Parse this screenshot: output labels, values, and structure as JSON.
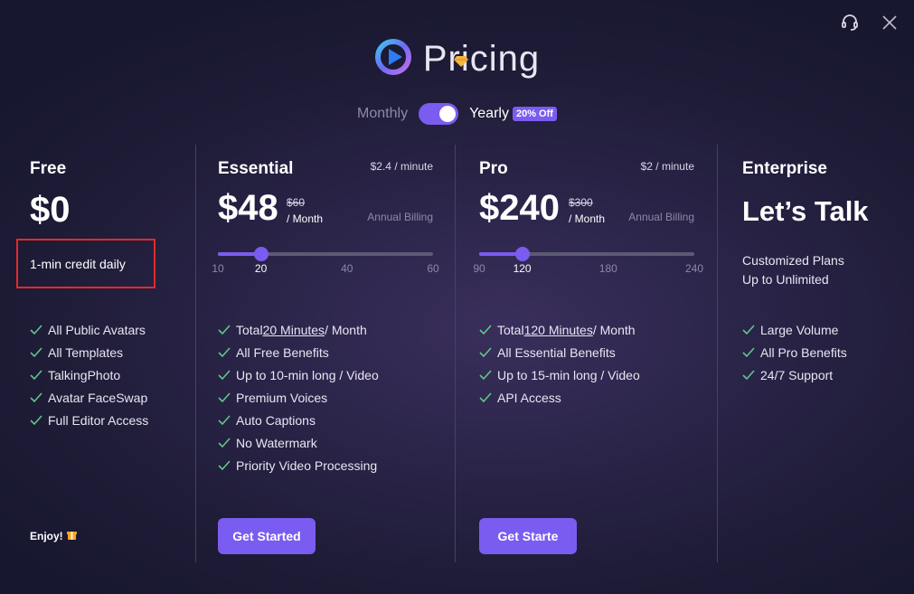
{
  "header": {
    "title": "Pricing",
    "icons": {
      "support": "headset-icon",
      "close": "close-icon",
      "logo": "play-logo-icon",
      "premium": "diamond-icon"
    }
  },
  "billing": {
    "monthly_label": "Monthly",
    "yearly_label": "Yearly",
    "discount_badge": "20% Off",
    "selected": "Yearly"
  },
  "colors": {
    "accent": "#7b5cf0",
    "highlight_border": "#e02b2b",
    "check": "#5fc78a"
  },
  "plans": {
    "free": {
      "name": "Free",
      "price": "$0",
      "credit": "1-min credit daily",
      "features": [
        "All Public Avatars",
        "All Templates",
        "TalkingPhoto",
        "Avatar FaceSwap",
        "Full Editor Access"
      ],
      "footer": "Enjoy!"
    },
    "essential": {
      "name": "Essential",
      "per_minute": "$2.4 / minute",
      "price": "$48",
      "original_price": "$60",
      "period": "/ Month",
      "billing_note": "Annual Billing",
      "slider": {
        "min": 10,
        "max": 60,
        "value": 20,
        "ticks": [
          "10",
          "20",
          "40",
          "60"
        ]
      },
      "features_total": {
        "prefix": "Total ",
        "amount": "20 Minutes",
        "suffix": " / Month"
      },
      "features": [
        "All Free Benefits",
        "Up to 10-min long / Video",
        "Premium Voices",
        "Auto Captions",
        "No Watermark",
        "Priority Video Processing"
      ],
      "cta": "Get Started"
    },
    "pro": {
      "name": "Pro",
      "per_minute": "$2 / minute",
      "price": "$240",
      "original_price": "$300",
      "period": "/ Month",
      "billing_note": "Annual Billing",
      "slider": {
        "min": 90,
        "max": 240,
        "value": 120,
        "ticks": [
          "90",
          "120",
          "180",
          "240"
        ]
      },
      "features_total": {
        "prefix": "Total ",
        "amount": "120 Minutes",
        "suffix": " / Month"
      },
      "features": [
        "All Essential Benefits",
        "Up to 15-min long / Video",
        "API Access"
      ],
      "cta": "Get Starte"
    },
    "enterprise": {
      "name": "Enterprise",
      "price": "Let’s Talk",
      "subtitle_line1": "Customized Plans",
      "subtitle_line2": "Up to Unlimited",
      "features": [
        "Large Volume",
        "All Pro Benefits",
        "24/7 Support"
      ]
    }
  }
}
